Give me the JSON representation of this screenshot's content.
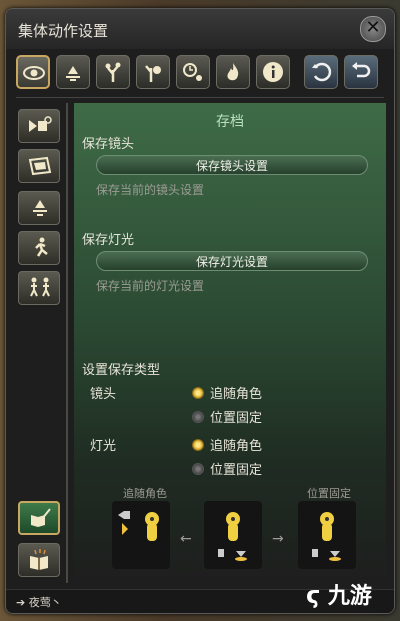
{
  "window": {
    "title": "集体动作设置",
    "close_icon": "close-x-icon"
  },
  "toolbar": {
    "icons": [
      "eye-icon",
      "light-icon",
      "tree-icon",
      "tree-alt-icon",
      "clock-sun-icon",
      "fire-icon",
      "info-icon",
      "reset-icon",
      "undo-icon"
    ]
  },
  "sidebar": {
    "icons": [
      "camera-gear-icon",
      "frame-icon",
      "lamp-icon",
      "running-figure-icon",
      "two-figures-icon"
    ],
    "bottom_icons": [
      "feather-book-icon",
      "open-book-icon"
    ]
  },
  "panel": {
    "section_title": "存档",
    "camera": {
      "label": "保存镜头",
      "button": "保存镜头设置",
      "hint": "保存当前的镜头设置"
    },
    "light": {
      "label": "保存灯光",
      "button": "保存灯光设置",
      "hint": "保存当前的灯光设置"
    },
    "save_type": {
      "heading": "设置保存类型",
      "camera_label": "镜头",
      "light_label": "灯光",
      "option_follow": "追随角色",
      "option_fixed": "位置固定",
      "camera_selected": "追随角色",
      "light_selected": "追随角色"
    },
    "diagram": {
      "left_label": "追随角色",
      "right_label": "位置固定",
      "left_arrow": "←",
      "right_arrow": "→"
    }
  },
  "footer": {
    "text": "➔ 夜莺丶"
  },
  "watermark": {
    "text": "九游"
  },
  "colors": {
    "accent": "#c8a860",
    "panel_green": "#3f6b47",
    "radio_on": "#ffd84a"
  }
}
